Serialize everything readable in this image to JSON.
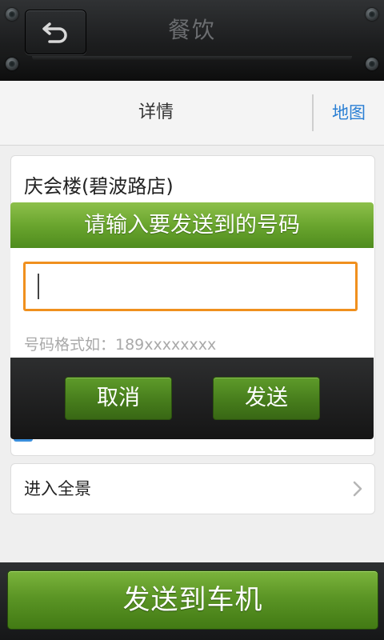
{
  "header": {
    "title": "餐饮",
    "back_icon": "back-arrow-icon"
  },
  "tabs": {
    "detail": "详情",
    "map": "地图"
  },
  "place": {
    "name": "庆会楼(碧波路店)"
  },
  "dialog": {
    "title": "请输入要发送到的号码",
    "input_value": "",
    "hint": "号码格式如：189xxxxxxxx",
    "cancel_label": "取消",
    "send_label": "发送"
  },
  "panorama": {
    "label": "进入全景",
    "chevron_icon": "chevron-right-icon"
  },
  "footer": {
    "send_to_car_label": "发送到车机"
  },
  "colors": {
    "accent_green": "#6aa52e",
    "input_border": "#f0901e",
    "link_blue": "#2a7fd4"
  }
}
